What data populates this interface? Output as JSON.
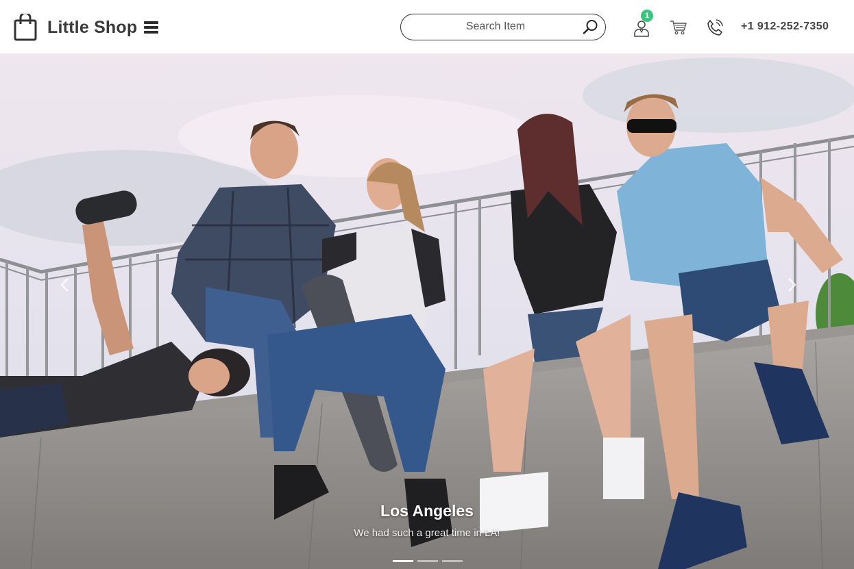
{
  "header": {
    "brand_name": "Little Shop",
    "search": {
      "placeholder": "Search Item"
    },
    "account_badge": "1",
    "phone": "+1 912-252-7350",
    "icons": [
      "shopping-bag-icon",
      "hamburger-menu-icon",
      "search-icon",
      "user-account-icon",
      "cart-icon",
      "phone-call-icon"
    ]
  },
  "hero": {
    "slide": {
      "title": "Los Angeles",
      "text": "We had such a great time in LA!"
    },
    "slide_count": 3,
    "active_slide": 1,
    "icons": [
      "carousel-prev-icon",
      "carousel-next-icon"
    ]
  },
  "colors": {
    "badge": "#3ac47d",
    "text_dark": "#3a3a3a",
    "header_bg": "#ffffff"
  }
}
